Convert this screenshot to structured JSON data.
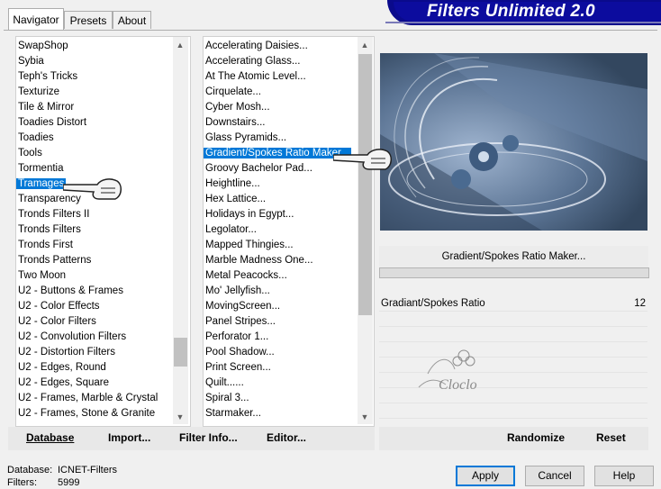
{
  "tabs": [
    {
      "label": "Navigator",
      "active": true
    },
    {
      "label": "Presets",
      "active": false
    },
    {
      "label": "About",
      "active": false
    }
  ],
  "banner": {
    "title": "Filters Unlimited 2.0"
  },
  "categories": {
    "items": [
      "SwapShop",
      "Sybia",
      "Teph's Tricks",
      "Texturize",
      "Tile & Mirror",
      "Toadies Distort",
      "Toadies",
      "Tools",
      "Tormentia",
      "Tramages",
      "Transparency",
      "Tronds Filters II",
      "Tronds Filters",
      "Tronds First",
      "Tronds Patterns",
      "Two Moon",
      "U2 - Buttons & Frames",
      "U2 - Color Effects",
      "U2 - Color Filters",
      "U2 - Convolution Filters",
      "U2 - Distortion Filters",
      "U2 - Edges, Round",
      "U2 - Edges, Square",
      "U2 - Frames, Marble & Crystal",
      "U2 - Frames, Stone & Granite"
    ],
    "selected": "Tramages",
    "scroll_position": 0.75
  },
  "filters": {
    "items": [
      "Accelerating Daisies...",
      "Accelerating Glass...",
      "At The Atomic Level...",
      "Cirquelate...",
      "Cyber Mosh...",
      "Downstairs...",
      "Glass Pyramids...",
      "Gradient/Spokes Ratio Maker...",
      "Groovy Bachelor Pad...",
      "Heightline...",
      "Hex Lattice...",
      "Holidays in Egypt...",
      "Legolator...",
      "Mapped Thingies...",
      "Marble Madness One...",
      "Metal Peacocks...",
      "Mo' Jellyfish...",
      "MovingScreen...",
      "Panel Stripes...",
      "Perforator 1...",
      "Pool Shadow...",
      "Print Screen...",
      "Quilt......",
      "Spiral 3...",
      "Starmaker..."
    ],
    "selected": "Gradient/Spokes Ratio Maker...",
    "scroll_position": 0.0
  },
  "left_bar": {
    "database": "Database",
    "import": "Import...",
    "filter_info": "Filter Info...",
    "editor": "Editor..."
  },
  "right_bar": {
    "randomize": "Randomize",
    "reset": "Reset"
  },
  "preview": {
    "filter_name": "Gradient/Spokes Ratio Maker...",
    "param_label": "Gradiant/Spokes Ratio",
    "param_value": "12",
    "watermark": "Cloclo"
  },
  "status": {
    "database_label": "Database:",
    "database_value": "ICNET-Filters",
    "filters_label": "Filters:",
    "filters_value": "5999"
  },
  "buttons": {
    "apply": "Apply",
    "cancel": "Cancel",
    "help": "Help"
  },
  "colors": {
    "selection": "#0078d7",
    "banner": "#0c0c9e",
    "preview_bg": "#4d6584"
  }
}
